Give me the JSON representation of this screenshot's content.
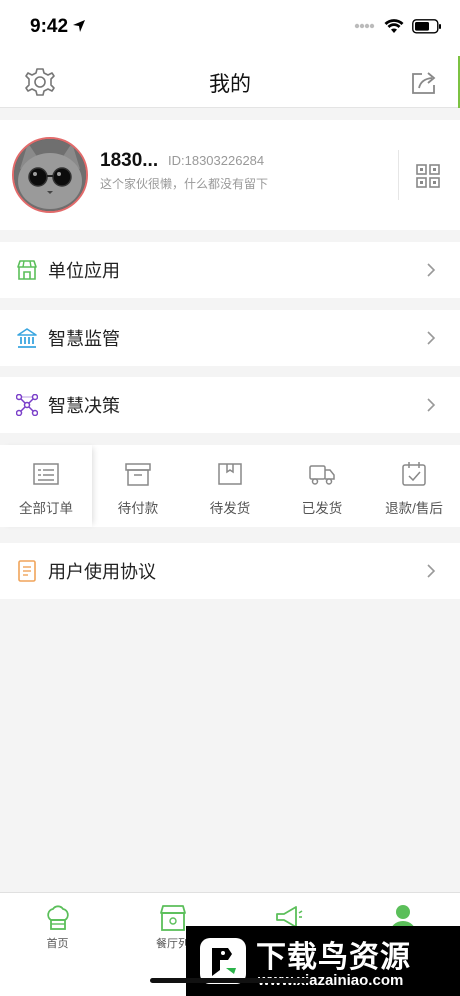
{
  "status": {
    "time": "9:42"
  },
  "nav": {
    "title": "我的",
    "settings_icon": "gear-icon",
    "share_icon": "share-icon"
  },
  "profile": {
    "name": "1830...",
    "id": "ID:18303226284",
    "bio": "这个家伙很懒，什么都没有留下",
    "avatar": "cat-with-sunglasses-avatar",
    "qr_icon": "qr-code-icon"
  },
  "menu": [
    {
      "label": "单位应用",
      "icon": "store-icon",
      "color": "#5bbf5a"
    },
    {
      "label": "智慧监管",
      "icon": "bank-icon",
      "color": "#3aa6e0"
    },
    {
      "label": "智慧决策",
      "icon": "network-icon",
      "color": "#7a3fc9"
    }
  ],
  "orders": [
    {
      "label": "全部订单",
      "icon": "list-icon"
    },
    {
      "label": "待付款",
      "icon": "wallet-icon"
    },
    {
      "label": "待发货",
      "icon": "package-icon"
    },
    {
      "label": "已发货",
      "icon": "truck-icon"
    },
    {
      "label": "退款/售后",
      "icon": "calendar-check-icon"
    }
  ],
  "agreement": {
    "label": "用户使用协议",
    "icon": "document-icon",
    "color": "#f0a45a"
  },
  "tabs": [
    {
      "label": "首页",
      "icon": "chef-hat-icon"
    },
    {
      "label": "餐厅列",
      "icon": "restaurant-icon"
    },
    {
      "label": "",
      "icon": "megaphone-icon"
    },
    {
      "label": "",
      "icon": "user-icon"
    }
  ],
  "watermark": {
    "title": "下载鸟资源",
    "url": "www.xiazainiao.com"
  },
  "colors": {
    "accent": "#7cc242",
    "page_bg": "#f4f4f4"
  }
}
